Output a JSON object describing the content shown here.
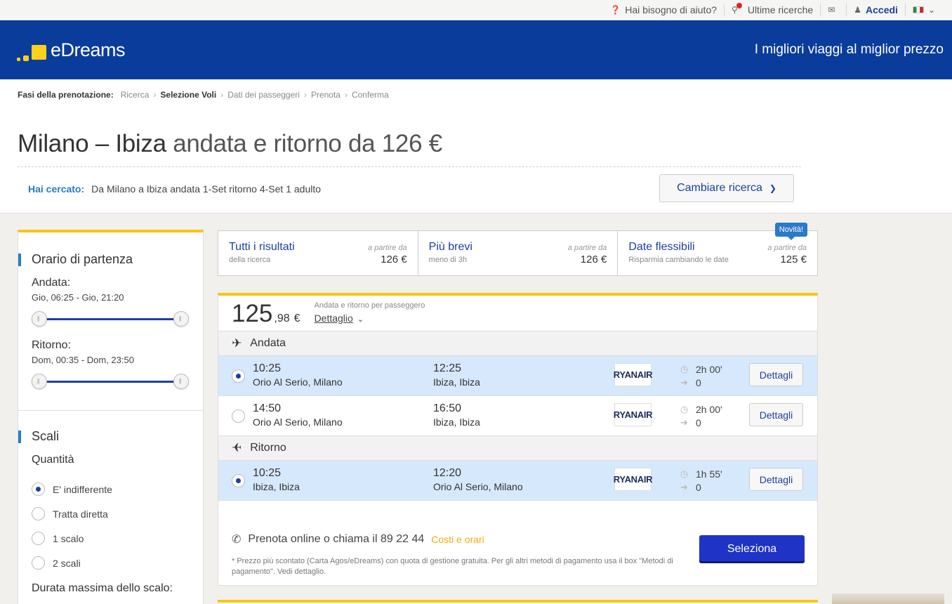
{
  "topbar": {
    "help": "Hai bisogno di aiuto?",
    "recent": "Ultime ricerche",
    "login": "Accedi"
  },
  "header": {
    "brand": "eDreams",
    "tagline": "I migliori viaggi al miglior prezzo"
  },
  "breadcrumb": {
    "label": "Fasi della prenotazione:",
    "steps": [
      "Ricerca",
      "Selezione Voli",
      "Dati dei passeggeri",
      "Prenota",
      "Conferma"
    ]
  },
  "title": {
    "cities": "Milano – Ibiza",
    "rest": "andata e ritorno da 126 €"
  },
  "search": {
    "label": "Hai cercato:",
    "text": "Da Milano a Ibiza andata 1-Set ritorno 4-Set 1 adulto",
    "change_label": "Cambiare ricerca"
  },
  "sidebar": {
    "departure": {
      "title": "Orario di partenza",
      "outbound_label": "Andata:",
      "outbound_range": "Gio, 06:25 - Gio, 21:20",
      "return_label": "Ritorno:",
      "return_range": "Dom, 00:35 - Dom, 23:50"
    },
    "stops": {
      "title": "Scali",
      "qty_label": "Quantità",
      "options": [
        "E' indifferente",
        "Tratta diretta",
        "1 scalo",
        "2 scali"
      ],
      "selected": 0,
      "max_duration_label": "Durata massima dello scalo:"
    }
  },
  "tabs": [
    {
      "title": "Tutti i risultati",
      "sub": "della ricerca",
      "from": "a partire da",
      "price": "126 €"
    },
    {
      "title": "Più brevi",
      "sub": "meno di 3h",
      "from": "a partire da",
      "price": "126 €"
    },
    {
      "title": "Date flessibili",
      "sub": "Risparmia cambiando le date",
      "from": "a partire da",
      "price": "125 €",
      "badge": "Novità!"
    }
  ],
  "result": {
    "price_int": "125",
    "price_dec": ",98",
    "currency": "€",
    "price_note": "Andata e ritorno per passeggero",
    "detail_label": "Dettaglio",
    "outbound_label": "Andata",
    "return_label": "Ritorno",
    "outbound_flights": [
      {
        "dep_time": "10:25",
        "dep_place": "Orio Al Serio, Milano",
        "arr_time": "12:25",
        "arr_place": "Ibiza, Ibiza",
        "airline": "RYANAIR",
        "duration": "2h 00'",
        "stops": "0",
        "button": "Dettagli",
        "selected": true
      },
      {
        "dep_time": "14:50",
        "dep_place": "Orio Al Serio, Milano",
        "arr_time": "16:50",
        "arr_place": "Ibiza, Ibiza",
        "airline": "RYANAIR",
        "duration": "2h 00'",
        "stops": "0",
        "button": "Dettagli",
        "selected": false
      }
    ],
    "return_flights": [
      {
        "dep_time": "10:25",
        "dep_place": "Ibiza, Ibiza",
        "arr_time": "12:20",
        "arr_place": "Orio Al Serio, Milano",
        "airline": "RYANAIR",
        "duration": "1h 55'",
        "stops": "0",
        "button": "Dettagli",
        "selected": true
      }
    ],
    "call_text": "Prenota online o chiama il 89 22 44",
    "call_link": "Costi e orari",
    "fine_print": "* Prezzo più scontato (Carta Agos/eDreams) con quota di gestione gratuita. Per gli altri metodi di pagamento usa il box \"Metodi di pagamento\". Vedi dettaglio.",
    "select_label": "Seleziona"
  },
  "colors": {
    "brand_blue": "#0a3c9c",
    "accent_yellow": "#f7c515",
    "link_blue": "#1d3fa0",
    "select_bg": "#d6e8fb"
  }
}
